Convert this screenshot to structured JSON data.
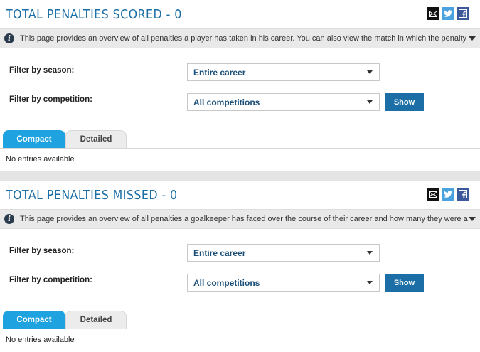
{
  "sections": [
    {
      "title": "TOTAL PENALTIES SCORED - 0",
      "info": "This page provides an overview of all penalties a player has taken in his career. You can also view the match in which the penalty was awarde...",
      "season_label": "Filter by season:",
      "season_value": "Entire career",
      "competition_label": "Filter by competition:",
      "competition_value": "All competitions",
      "show_label": "Show",
      "tabs": [
        "Compact",
        "Detailed"
      ],
      "empty_text": "No entries available"
    },
    {
      "title": "TOTAL PENALTIES MISSED - 0",
      "info": "This page provides an overview of all penalties a goalkeeper has faced over the course of their career and how many they were able to save. Y...",
      "season_label": "Filter by season:",
      "season_value": "Entire career",
      "competition_label": "Filter by competition:",
      "competition_value": "All competitions",
      "show_label": "Show",
      "tabs": [
        "Compact",
        "Detailed"
      ],
      "empty_text": "No entries available"
    }
  ],
  "share_icons": [
    "mail-icon",
    "twitter-icon",
    "facebook-icon"
  ],
  "colors": {
    "title": "#1b6fa6",
    "tab_active": "#1ea3e0",
    "button": "#1b6fa6"
  }
}
